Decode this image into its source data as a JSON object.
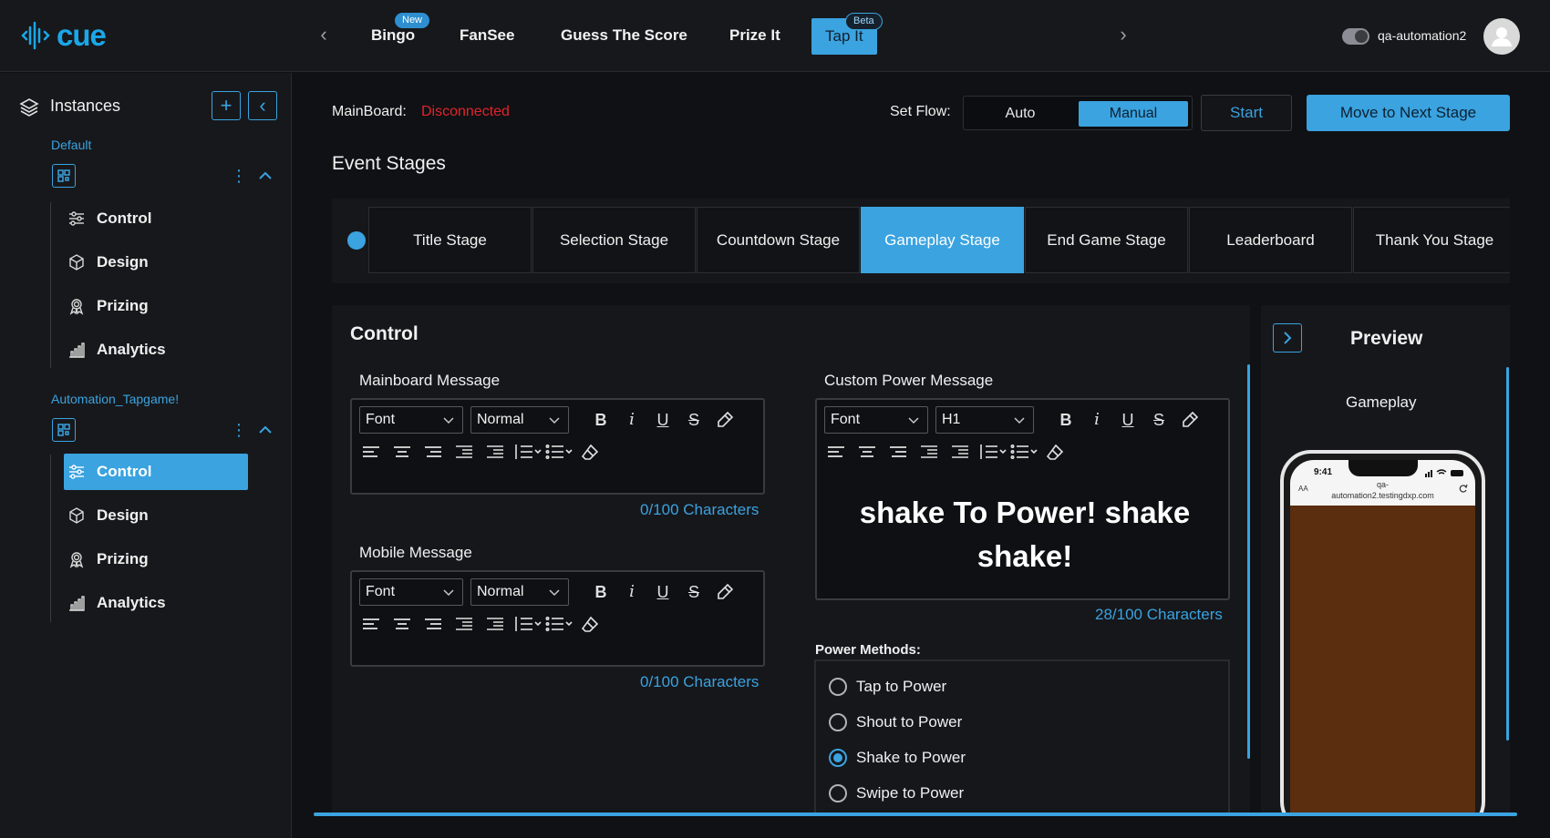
{
  "app": {
    "logo_text": "cue",
    "brand_color": "#3aa3e0"
  },
  "nav": {
    "tabs": [
      {
        "label": "Bingo",
        "badge": "New"
      },
      {
        "label": "FanSee",
        "badge": ""
      },
      {
        "label": "Guess The Score",
        "badge": ""
      },
      {
        "label": "Prize It",
        "badge": ""
      },
      {
        "label": "Tap It",
        "badge": "Beta",
        "active": true
      }
    ],
    "username": "qa-automation2"
  },
  "sidebar": {
    "title": "Instances",
    "groups": [
      {
        "name": "Default",
        "items": [
          "Control",
          "Design",
          "Prizing",
          "Analytics"
        ]
      },
      {
        "name": "Automation_Tapgame!",
        "items": [
          "Control",
          "Design",
          "Prizing",
          "Analytics"
        ],
        "active_item": "Control"
      }
    ]
  },
  "header": {
    "mainboard_label": "MainBoard:",
    "mainboard_status": "Disconnected",
    "mainboard_status_color": "#e0242b",
    "set_flow_label": "Set Flow:",
    "flow_options": [
      "Auto",
      "Manual"
    ],
    "flow_selected": "Manual",
    "start_label": "Start",
    "next_label": "Move to Next Stage"
  },
  "event_stages": {
    "title": "Event Stages",
    "stages": [
      "Title Stage",
      "Selection Stage",
      "Countdown Stage",
      "Gameplay Stage",
      "End Game Stage",
      "Leaderboard",
      "Thank You Stage"
    ],
    "active": "Gameplay Stage"
  },
  "control": {
    "title": "Control",
    "mainboard_message": {
      "label": "Mainboard Message",
      "font": "Font",
      "size": "Normal",
      "counter": "0/100 Characters"
    },
    "mobile_message": {
      "label": "Mobile Message",
      "font": "Font",
      "size": "Normal",
      "counter": "0/100 Characters"
    },
    "custom_power_message": {
      "label": "Custom Power Message",
      "font": "Font",
      "size": "H1",
      "text": "shake To Power! shake shake!",
      "counter": "28/100 Characters"
    },
    "power_methods": {
      "label": "Power Methods:",
      "options": [
        "Tap to Power",
        "Shout to Power",
        "Shake to Power",
        "Swipe to Power"
      ],
      "selected": "Shake to Power"
    }
  },
  "preview": {
    "title": "Preview",
    "subtitle": "Gameplay",
    "phone_time": "9:41",
    "phone_url_line1": "qa-",
    "phone_url_line2": "automation2.testingdxp.com",
    "phone_text_size": "AA",
    "screen_color": "#5a2e0f"
  }
}
